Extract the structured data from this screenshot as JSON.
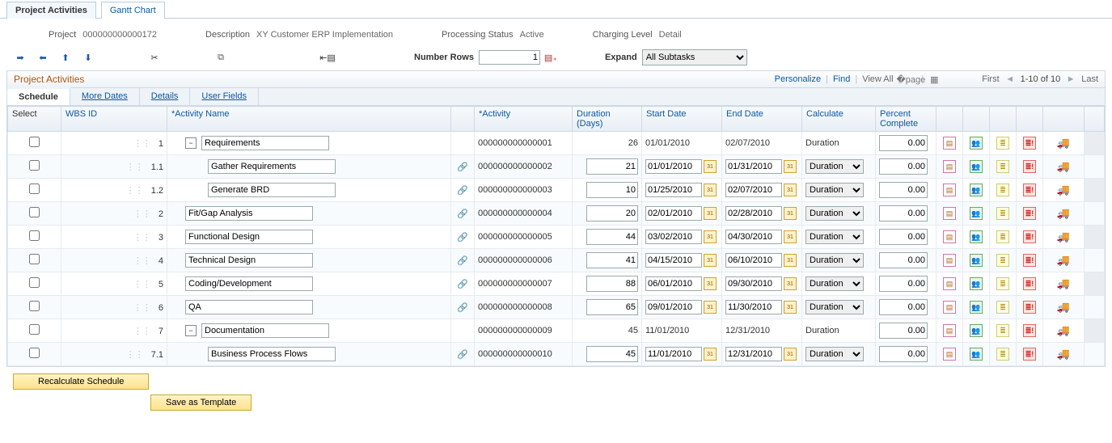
{
  "pageTabs": {
    "active": "Project Activities",
    "other": "Gantt Chart"
  },
  "header": {
    "project_lbl": "Project",
    "project_val": "000000000000172",
    "desc_lbl": "Description",
    "desc_val": "XY Customer ERP Implementation",
    "status_lbl": "Processing Status",
    "status_val": "Active",
    "charge_lbl": "Charging Level",
    "charge_val": "Detail"
  },
  "toolbar": {
    "numrows_lbl": "Number Rows",
    "numrows_val": "1",
    "expand_lbl": "Expand",
    "expand_val": "All Subtasks"
  },
  "grid": {
    "title": "Project Activities",
    "personalize": "Personalize",
    "find": "Find",
    "viewall": "View All",
    "first": "First",
    "range": "1-10 of 10",
    "last": "Last"
  },
  "innerTabs": [
    "Schedule",
    "More Dates",
    "Details",
    "User Fields"
  ],
  "cols": {
    "select": "Select",
    "wbs": "WBS ID",
    "name": "*Activity Name",
    "act": "*Activity",
    "dur": "Duration (Days)",
    "start": "Start Date",
    "end": "End Date",
    "calc": "Calculate",
    "pct": "Percent Complete"
  },
  "rows": [
    {
      "wbs": "1",
      "name": "Requirements",
      "act": "000000000000001",
      "dur": "26",
      "start": "01/01/2010",
      "end": "02/07/2010",
      "calc": "Duration",
      "pct": "0.00",
      "parent": true,
      "indent": 0
    },
    {
      "wbs": "1.1",
      "name": "Gather Requirements",
      "act": "000000000000002",
      "dur": "21",
      "start": "01/01/2010",
      "end": "01/31/2010",
      "calc": "Duration",
      "pct": "0.00",
      "parent": false,
      "indent": 1
    },
    {
      "wbs": "1.2",
      "name": "Generate BRD",
      "act": "000000000000003",
      "dur": "10",
      "start": "01/25/2010",
      "end": "02/07/2010",
      "calc": "Duration",
      "pct": "0.00",
      "parent": false,
      "indent": 1
    },
    {
      "wbs": "2",
      "name": "Fit/Gap Analysis",
      "act": "000000000000004",
      "dur": "20",
      "start": "02/01/2010",
      "end": "02/28/2010",
      "calc": "Duration",
      "pct": "0.00",
      "parent": false,
      "indent": 0
    },
    {
      "wbs": "3",
      "name": "Functional Design",
      "act": "000000000000005",
      "dur": "44",
      "start": "03/02/2010",
      "end": "04/30/2010",
      "calc": "Duration",
      "pct": "0.00",
      "parent": false,
      "indent": 0
    },
    {
      "wbs": "4",
      "name": "Technical Design",
      "act": "000000000000006",
      "dur": "41",
      "start": "04/15/2010",
      "end": "06/10/2010",
      "calc": "Duration",
      "pct": "0.00",
      "parent": false,
      "indent": 0
    },
    {
      "wbs": "5",
      "name": "Coding/Development",
      "act": "000000000000007",
      "dur": "88",
      "start": "06/01/2010",
      "end": "09/30/2010",
      "calc": "Duration",
      "pct": "0.00",
      "parent": false,
      "indent": 0
    },
    {
      "wbs": "6",
      "name": "QA",
      "act": "000000000000008",
      "dur": "65",
      "start": "09/01/2010",
      "end": "11/30/2010",
      "calc": "Duration",
      "pct": "0.00",
      "parent": false,
      "indent": 0
    },
    {
      "wbs": "7",
      "name": "Documentation",
      "act": "000000000000009",
      "dur": "45",
      "start": "11/01/2010",
      "end": "12/31/2010",
      "calc": "Duration",
      "pct": "0.00",
      "parent": true,
      "indent": 0
    },
    {
      "wbs": "7.1",
      "name": "Business Process Flows",
      "act": "000000000000010",
      "dur": "45",
      "start": "11/01/2010",
      "end": "12/31/2010",
      "calc": "Duration",
      "pct": "0.00",
      "parent": false,
      "indent": 1
    }
  ],
  "buttons": {
    "recalc": "Recalculate Schedule",
    "save": "Save as Template"
  }
}
